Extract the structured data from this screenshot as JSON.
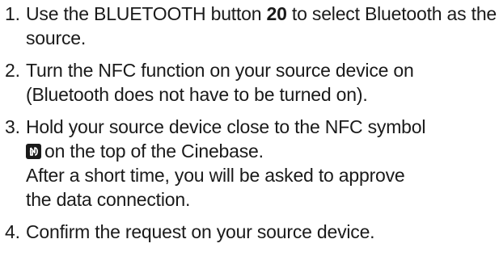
{
  "steps": [
    {
      "number": "1.",
      "text_before": "Use the BLUETOOTH button ",
      "bold": "20",
      "text_after": " to select Bluetooth as the source."
    },
    {
      "number": "2.",
      "line1": "Turn the NFC function on your source device on",
      "line2": "(Bluetooth does not have to be turned on)."
    },
    {
      "number": "3.",
      "line1": "Hold your source device close to the NFC symbol",
      "icon": "nfc-icon",
      "line2": "on the top of the Cinebase.",
      "line3": "After a short time, you will be asked to approve",
      "line4": "the data connection."
    },
    {
      "number": "4.",
      "line1": "Confirm the request on your source device."
    }
  ]
}
